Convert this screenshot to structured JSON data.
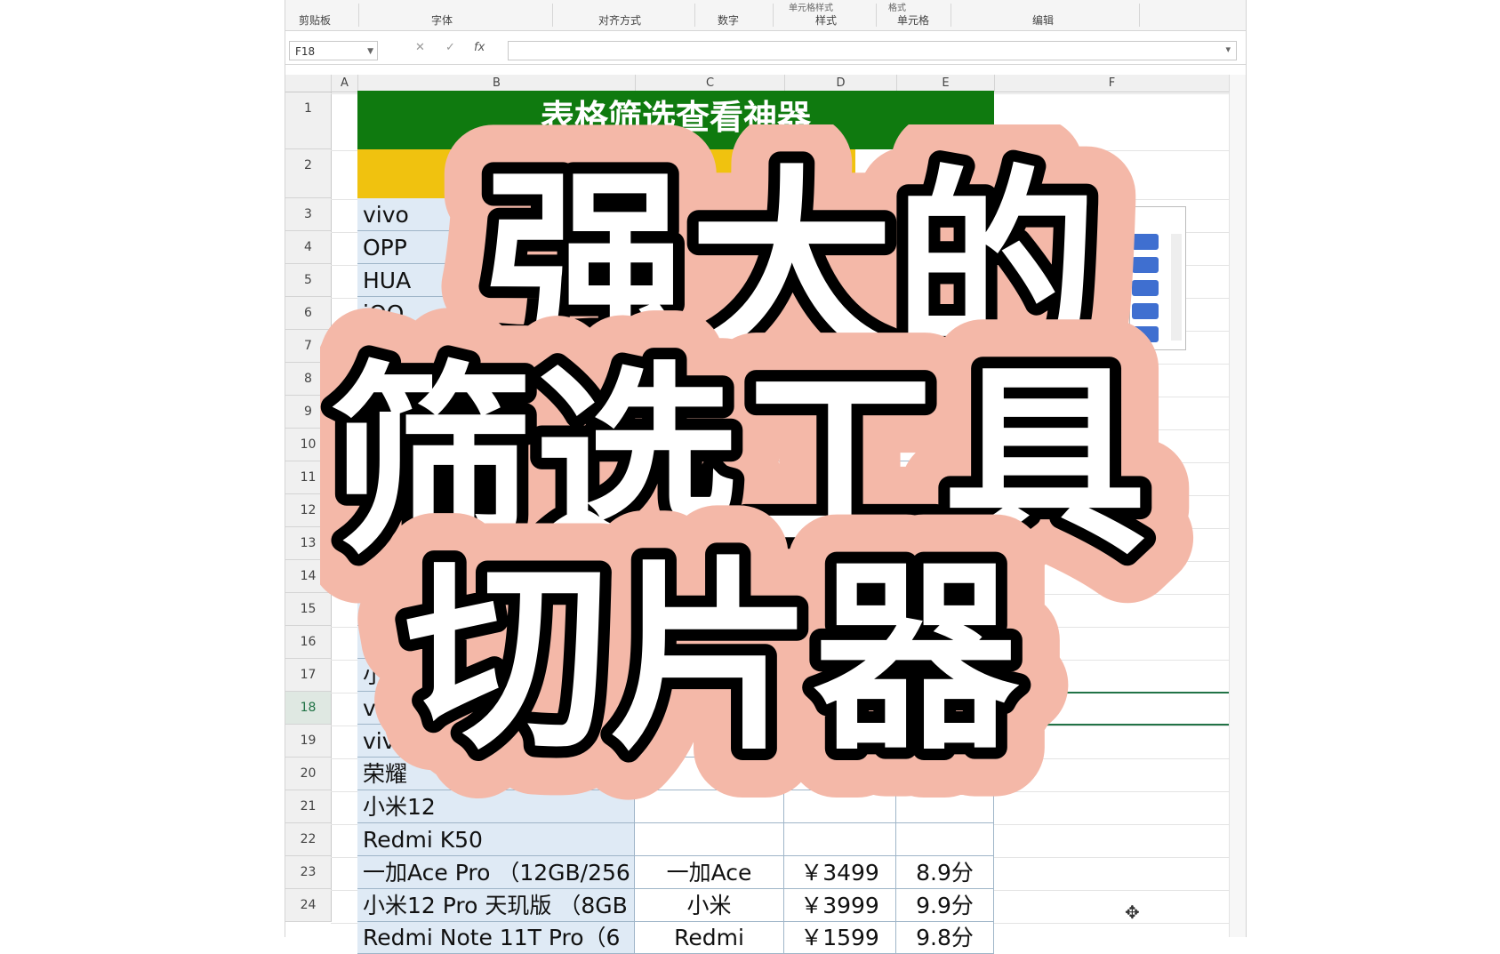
{
  "ribbon": {
    "groups": [
      "剪贴板",
      "字体",
      "对齐方式",
      "数字",
      "样式",
      "单元格",
      "编辑"
    ],
    "top_labels": [
      "单元格样式",
      "格式"
    ]
  },
  "formula_bar": {
    "name_box": "F18",
    "cancel_icon": "✕",
    "confirm_icon": "✓",
    "fx_label": "fx",
    "formula": ""
  },
  "columns": [
    "A",
    "B",
    "C",
    "D",
    "E",
    "F"
  ],
  "rows": [
    "1",
    "2",
    "3",
    "4",
    "5",
    "6",
    "7",
    "8",
    "9",
    "10",
    "11",
    "12",
    "13",
    "14",
    "15",
    "16",
    "17",
    "18",
    "19",
    "20",
    "21",
    "22",
    "23",
    "24"
  ],
  "selected_row": "18",
  "sheet": {
    "title": "表格筛选查看神器",
    "data_rows": [
      {
        "b": "vivo",
        "c": "",
        "d": "",
        "e": ""
      },
      {
        "b": "OPP",
        "c": "",
        "d": "",
        "e": ""
      },
      {
        "b": "HUA",
        "c": "",
        "d": "",
        "e": ""
      },
      {
        "b": "iQO",
        "c": "",
        "d": "",
        "e": ""
      },
      {
        "b": "",
        "c": "",
        "d": "",
        "e": ""
      },
      {
        "b": "",
        "c": "",
        "d": "",
        "e": ""
      },
      {
        "b": "",
        "c": "",
        "d": "",
        "e": ""
      },
      {
        "b": "",
        "c": "",
        "d": "",
        "e": ""
      },
      {
        "b": "",
        "c": "",
        "d": "",
        "e": ""
      },
      {
        "b": "",
        "c": "",
        "d": "",
        "e": ""
      },
      {
        "b": "",
        "c": "",
        "d": "",
        "e": ""
      },
      {
        "b": "",
        "c": "",
        "d": "",
        "e": ""
      },
      {
        "b": "",
        "c": "",
        "d": "",
        "e": ""
      },
      {
        "b": "",
        "c": "",
        "d": "",
        "e": ""
      },
      {
        "b": "小米",
        "c": "",
        "d": "",
        "e": ""
      },
      {
        "b": "vivo",
        "c": "",
        "d": "",
        "e": ""
      },
      {
        "b": "vivo",
        "c": "",
        "d": "",
        "e": ""
      },
      {
        "b": "荣耀",
        "c": "",
        "d": "",
        "e": ""
      },
      {
        "b": "小米12",
        "c": "",
        "d": "",
        "e": ""
      },
      {
        "b": "Redmi K50",
        "c": "",
        "d": "",
        "e": ""
      },
      {
        "b": "一加Ace Pro （12GB/256",
        "c": "一加Ace",
        "d": "￥3499",
        "e": "8.9分"
      },
      {
        "b": "小米12 Pro 天玑版 （8GB",
        "c": "小米",
        "d": "￥3999",
        "e": "9.9分"
      },
      {
        "b": "Redmi Note 11T Pro（6",
        "c": "Redmi",
        "d": "￥1599",
        "e": "9.8分"
      }
    ]
  },
  "overlay": {
    "line1": "强大的",
    "line2": "筛选工具",
    "line3": "切片器",
    "outline_color": "#f4b8a8",
    "stroke_color": "#000000",
    "fill_color": "#ffffff"
  },
  "colors": {
    "title_bg": "#0f7a0f",
    "header_bg": "#f0c20f",
    "col_b_bg": "#dfeaf5",
    "slicer_button": "#3f6fd0",
    "selection": "#217346"
  },
  "icons": {
    "cursor": "✥"
  }
}
